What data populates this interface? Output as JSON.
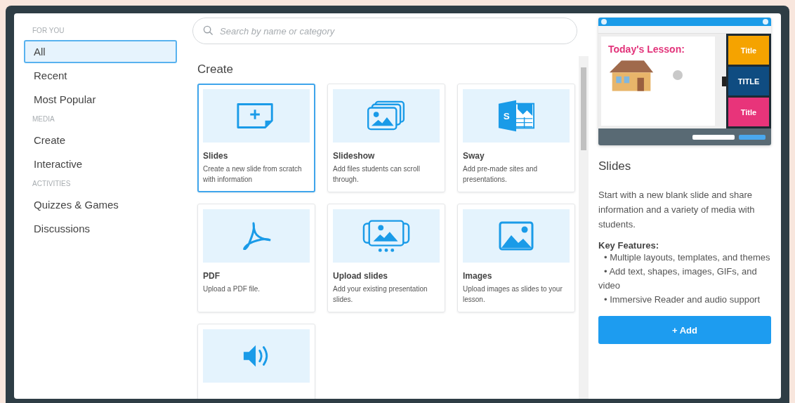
{
  "sidebar": {
    "sections": [
      {
        "heading": "FOR YOU",
        "items": [
          {
            "label": "All",
            "selected": true
          },
          {
            "label": "Recent",
            "selected": false
          },
          {
            "label": "Most Popular",
            "selected": false
          }
        ]
      },
      {
        "heading": "MEDIA",
        "items": [
          {
            "label": "Create",
            "selected": false
          },
          {
            "label": "Interactive",
            "selected": false
          }
        ]
      },
      {
        "heading": "ACTIVITIES",
        "items": [
          {
            "label": "Quizzes & Games",
            "selected": false
          },
          {
            "label": "Discussions",
            "selected": false
          }
        ]
      }
    ]
  },
  "search": {
    "placeholder": "Search by name or category"
  },
  "section_title": "Create",
  "cards": [
    {
      "kind": "slides",
      "title": "Slides",
      "description": "Create a new slide from scratch with information",
      "selected": true
    },
    {
      "kind": "slideshow",
      "title": "Slideshow",
      "description": "Add files students can scroll through.",
      "selected": false
    },
    {
      "kind": "sway",
      "icon_letter": "S",
      "title": "Sway",
      "description": "Add pre-made sites and presentations.",
      "selected": false
    },
    {
      "kind": "pdf",
      "title": "PDF",
      "description": "Upload a PDF file.",
      "selected": false
    },
    {
      "kind": "upload",
      "title": "Upload slides",
      "description": "Add your existing presentation slides.",
      "selected": false
    },
    {
      "kind": "images",
      "title": "Images",
      "description": "Upload images as slides to your lesson.",
      "selected": false
    },
    {
      "kind": "audio",
      "selected": false
    }
  ],
  "preview": {
    "slide_title": "Today's Lesson:",
    "layouts": [
      {
        "title": "Title",
        "color": "#f5a300"
      },
      {
        "title": "TITLE",
        "color": "#0f4c81"
      },
      {
        "title": "Title",
        "color": "#e8347a"
      }
    ]
  },
  "detail": {
    "title": "Slides",
    "description": "Start with a new blank slide and share information and a variety of media with students.",
    "features_heading": "Key Features:",
    "features": [
      "• Multiple layouts, templates, and themes",
      "• Add text, shapes, images, GIFs, and video",
      "• Immersive Reader and audio support"
    ],
    "button": "+ Add"
  }
}
